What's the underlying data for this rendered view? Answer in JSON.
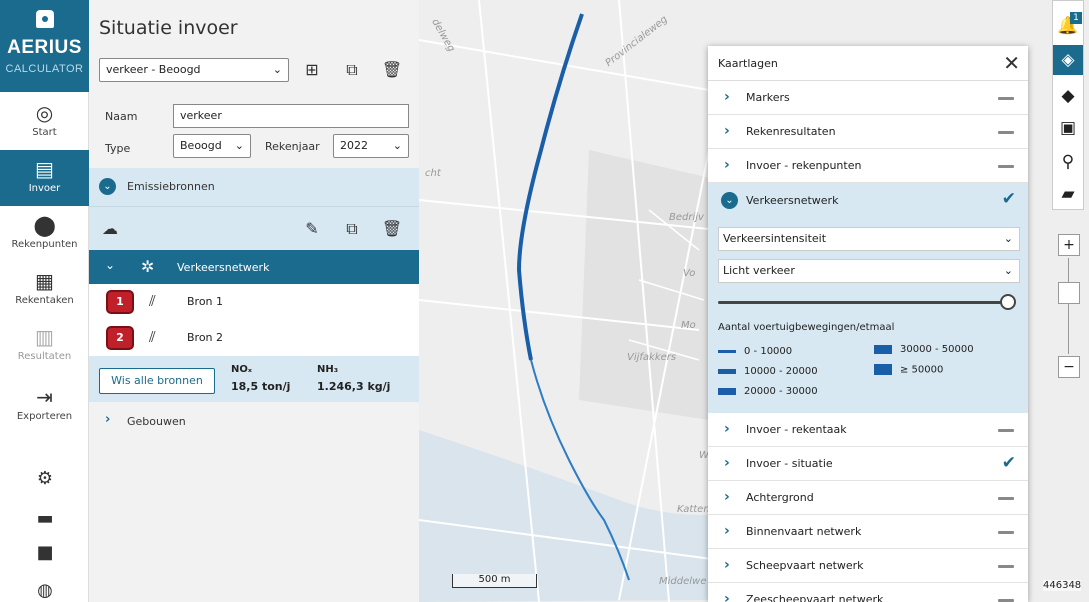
{
  "app": {
    "brand": "AERIUS",
    "sub": "CALCULATOR"
  },
  "nav": {
    "items": [
      {
        "label": "Start",
        "icon": "target-icon"
      },
      {
        "label": "Invoer",
        "icon": "clipboard-icon"
      },
      {
        "label": "Rekenpunten",
        "icon": "pin-icon"
      },
      {
        "label": "Rekentaken",
        "icon": "calculator-icon"
      },
      {
        "label": "Resultaten",
        "icon": "bar-chart-icon"
      },
      {
        "label": "Exporteren",
        "icon": "export-icon"
      }
    ]
  },
  "panel": {
    "title": "Situatie invoer",
    "situation_select": "verkeer - Beoogd",
    "naam_label": "Naam",
    "naam_value": "verkeer",
    "type_label": "Type",
    "type_value": "Beoogd",
    "rekenjaar_label": "Rekenjaar",
    "rekenjaar_value": "2022",
    "emissie_label": "Emissiebronnen",
    "group_label": "Verkeersnetwerk",
    "bronnen": [
      {
        "num": "1",
        "name": "Bron 1"
      },
      {
        "num": "2",
        "name": "Bron 2"
      }
    ],
    "wis_label": "Wis alle bronnen",
    "nox_label": "NOₓ",
    "nox_value": "18,5 ton/j",
    "nh3_label": "NH₃",
    "nh3_value": "1.246,3 kg/j",
    "gebouwen_label": "Gebouwen"
  },
  "map": {
    "labels": [
      "Bedrijv",
      "Vo",
      "Mo",
      "Vijfakkers",
      "Katten",
      "Middelwe",
      "W",
      "cht",
      "Provincialeweg",
      "delweg"
    ],
    "scale": "500 m",
    "coord": "446348"
  },
  "layers": {
    "title": "Kaartlagen",
    "rows_top": [
      {
        "name": "Markers",
        "state": "dash"
      },
      {
        "name": "Rekenresultaten",
        "state": "dash"
      },
      {
        "name": "Invoer - rekenpunten",
        "state": "dash"
      }
    ],
    "expanded": {
      "name": "Verkeersnetwerk",
      "select1": "Verkeersintensiteit",
      "select2": "Licht verkeer",
      "slider_value": 1.0,
      "legend_title": "Aantal voertuigbewegingen/etmaal",
      "legend": [
        {
          "label": "0 - 10000"
        },
        {
          "label": "30000 - 50000"
        },
        {
          "label": "10000 - 20000"
        },
        {
          "label": "≥ 50000"
        },
        {
          "label": "20000 - 30000"
        }
      ]
    },
    "rows_bottom": [
      {
        "name": "Invoer - rekentaak",
        "state": "dash"
      },
      {
        "name": "Invoer - situatie",
        "state": "check"
      },
      {
        "name": "Achtergrond",
        "state": "dash"
      },
      {
        "name": "Binnenvaart netwerk",
        "state": "dash"
      },
      {
        "name": "Scheepvaart netwerk",
        "state": "dash"
      },
      {
        "name": "Zeescheepvaart netwerk",
        "state": "dash"
      }
    ]
  },
  "toolbar": {
    "notif_count": "1"
  },
  "colors": {
    "primary": "#1a6b8e",
    "light": "#d7e8f2",
    "badge": "#c0202a",
    "road": "#1a5ea8"
  }
}
